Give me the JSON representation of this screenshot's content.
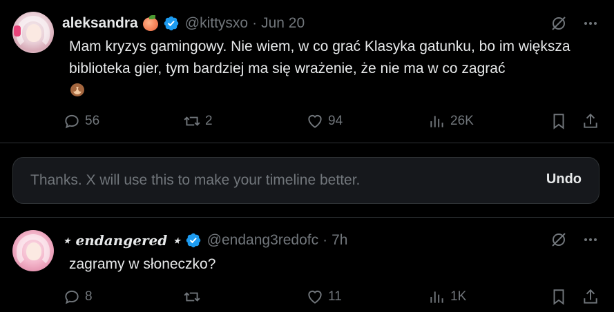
{
  "tweets": [
    {
      "author": "aleksandra",
      "handle": "@kittysxo",
      "separator": "·",
      "time": "Jun 20",
      "text": "Mam kryzys gamingowy. Nie wiem, w co grać Klasyka gatunku, bo im większa biblioteka gier, tym bardziej ma się wrażenie, że nie ma w co zagrać",
      "replies": "56",
      "reposts": "2",
      "likes": "94",
      "views": "26K"
    },
    {
      "author": "⋆ endangered ⋆",
      "handle": "@endang3redofc",
      "separator": "·",
      "time": "7h",
      "text": "zagramy w słoneczko?",
      "replies": "8",
      "reposts": "",
      "likes": "11",
      "views": "1K"
    }
  ],
  "notice": {
    "text": "Thanks. X will use this to make your timeline better.",
    "undo_label": "Undo"
  },
  "colors": {
    "background": "#000000",
    "text": "#e7e9ea",
    "muted": "#71767b",
    "verified": "#1d9bf0",
    "border": "#2f3336"
  }
}
